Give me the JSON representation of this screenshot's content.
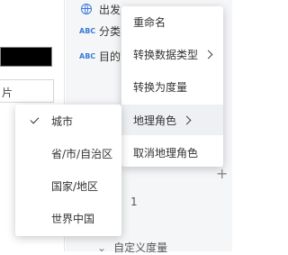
{
  "left_panel": {
    "input_value": "片"
  },
  "field_list": [
    {
      "icon": "globe-icon",
      "name": "出发"
    },
    {
      "icon": "abc-icon",
      "icon_text": "ABC",
      "name": "分类"
    },
    {
      "icon": "abc-icon",
      "icon_text": "ABC",
      "name": "目的"
    }
  ],
  "context_menu": {
    "items": [
      {
        "label": "重命名",
        "has_submenu": false
      },
      {
        "label": "转换数据类型",
        "has_submenu": true
      },
      {
        "label": "转换为度量",
        "has_submenu": false
      },
      {
        "label": "地理角色",
        "has_submenu": true,
        "active": true
      },
      {
        "label": "取消地理角色",
        "has_submenu": false
      }
    ]
  },
  "geo_role_submenu": {
    "selected": "城市",
    "items": [
      {
        "label": "城市",
        "checked": true
      },
      {
        "label": "省/市/自治区",
        "checked": false
      },
      {
        "label": "国家/地区",
        "checked": false
      },
      {
        "label": "世界中国",
        "checked": false
      }
    ]
  },
  "background_partials": {
    "partial_number": "1",
    "partial_section": "自定义度量",
    "add_symbol": "+"
  },
  "colors": {
    "accent": "#3a7bd5",
    "menu_hover": "#eef0f3",
    "panel_bg": "#f5f6f8"
  }
}
